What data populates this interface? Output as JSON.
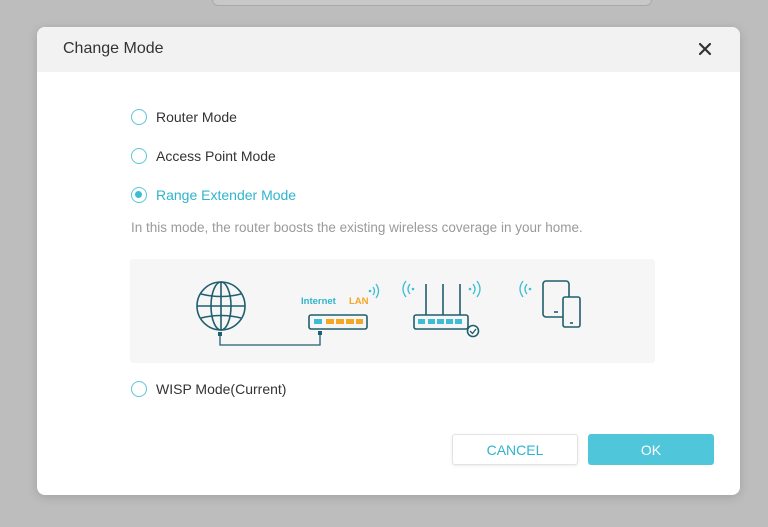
{
  "dialog": {
    "title": "Change Mode",
    "close_icon": "close-icon"
  },
  "options": [
    {
      "label": "Router Mode",
      "checked": false
    },
    {
      "label": "Access Point Mode",
      "checked": false
    },
    {
      "label": "Range Extender Mode",
      "checked": true
    },
    {
      "label": "WISP Mode(Current)",
      "checked": false
    }
  ],
  "description": "In this mode, the router boosts the existing wireless coverage in your home.",
  "illustration": {
    "internet_label": "Internet",
    "lan_label": "LAN",
    "icons": [
      "globe-icon",
      "modem-icon",
      "router-icon",
      "devices-icon"
    ]
  },
  "buttons": {
    "cancel": "CANCEL",
    "ok": "OK"
  },
  "colors": {
    "accent": "#3dbdd3",
    "illustration_line": "#1f5f6e",
    "lan_color": "#f5a623"
  }
}
